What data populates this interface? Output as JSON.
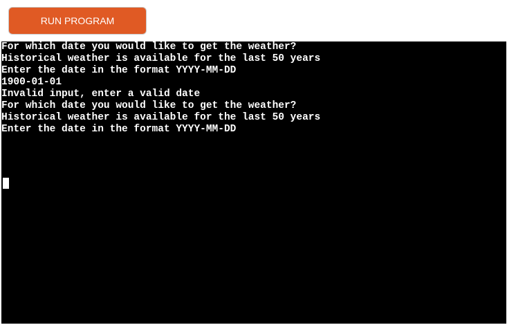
{
  "toolbar": {
    "run_label": "RUN PROGRAM",
    "run_color": "#e05a24"
  },
  "terminal": {
    "background": "#000000",
    "foreground": "#ffffff",
    "lines": [
      "For which date you would like to get the weather?",
      "Historical weather is available for the last 50 years",
      "Enter the date in the format YYYY-MM-DD",
      "1900-01-01",
      "Invalid input, enter a valid date",
      "For which date you would like to get the weather?",
      "Historical weather is available for the last 50 years",
      "Enter the date in the format YYYY-MM-DD"
    ]
  }
}
